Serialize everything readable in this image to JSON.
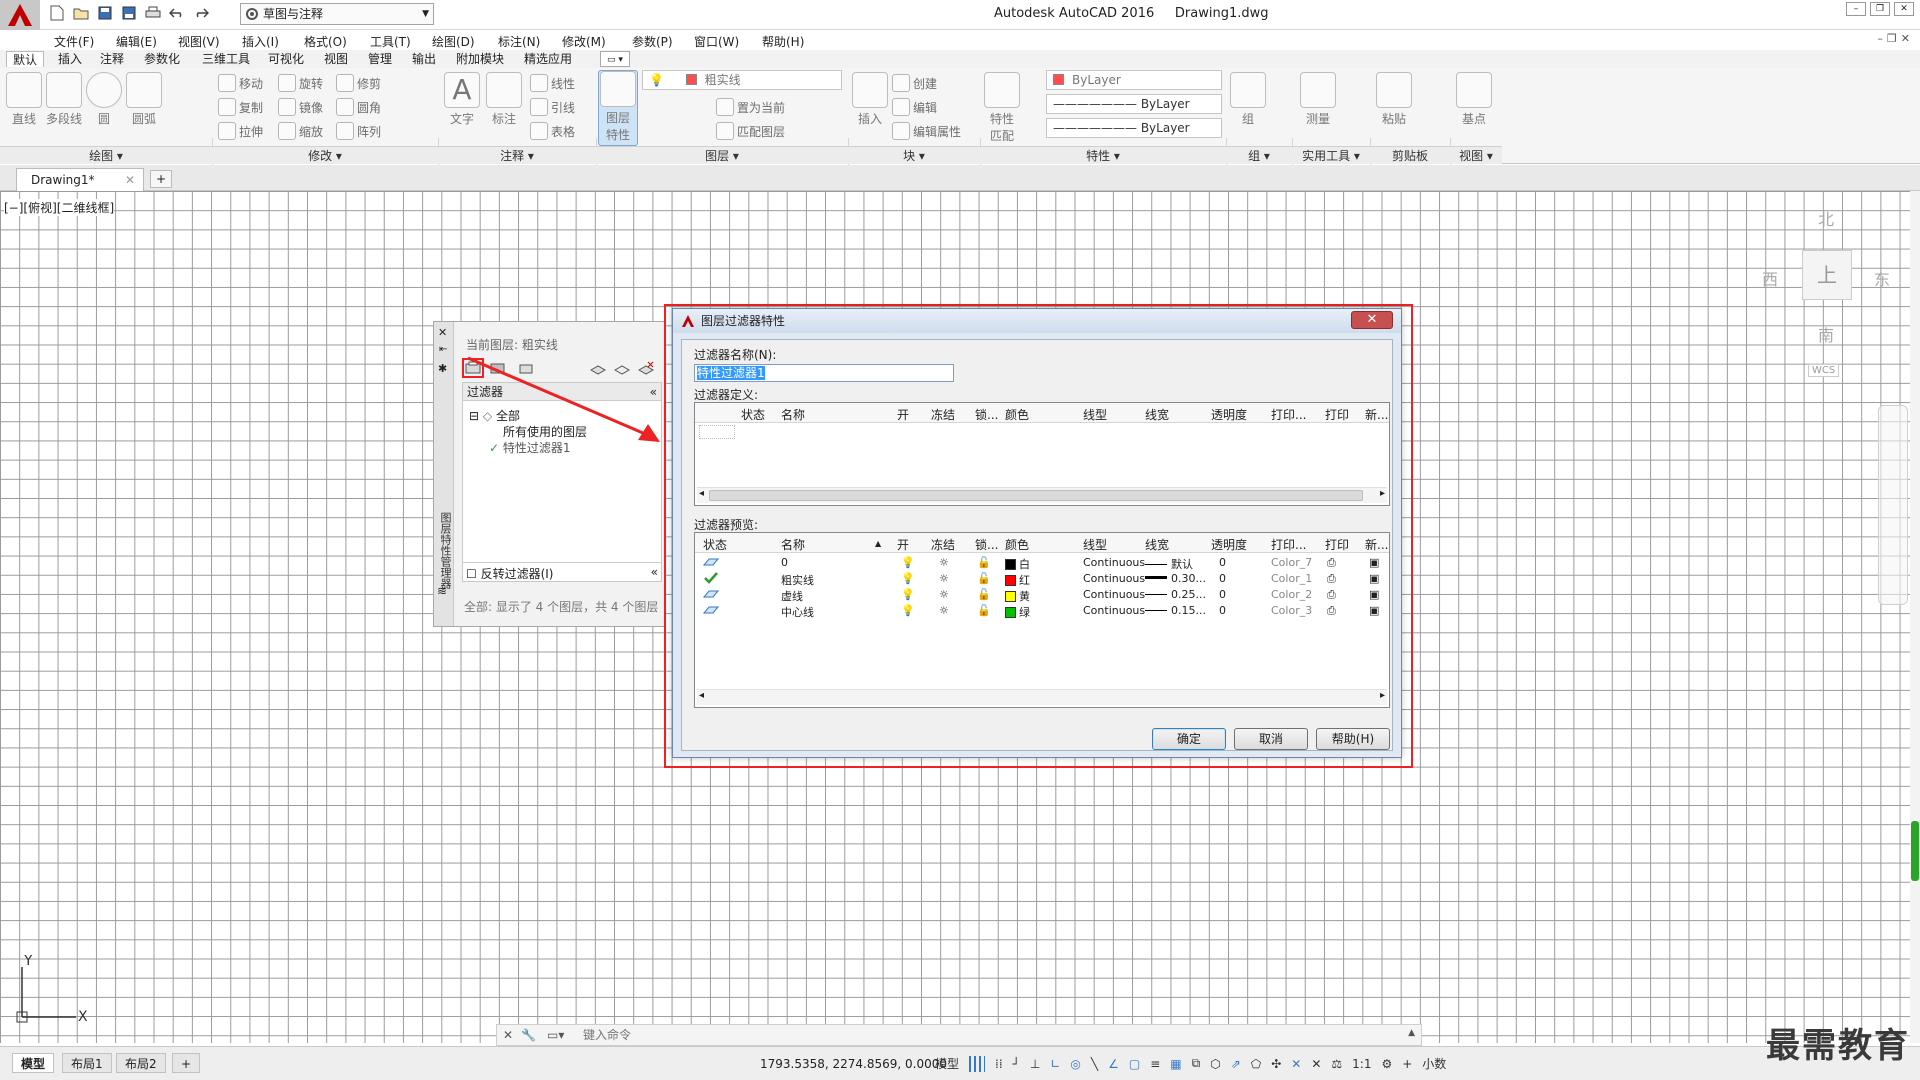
{
  "titlebar": {
    "workspace": "草图与注释",
    "app_title": "Autodesk AutoCAD 2016",
    "doc_title": "Drawing1.dwg"
  },
  "menu": [
    "文件(F)",
    "编辑(E)",
    "视图(V)",
    "插入(I)",
    "格式(O)",
    "工具(T)",
    "绘图(D)",
    "标注(N)",
    "修改(M)",
    "参数(P)",
    "窗口(W)",
    "帮助(H)"
  ],
  "ribbon_tabs": [
    "默认",
    "插入",
    "注释",
    "参数化",
    "三维工具",
    "可视化",
    "视图",
    "管理",
    "输出",
    "附加模块",
    "精选应用"
  ],
  "ribbon": {
    "draw": [
      "直线",
      "多段线",
      "圆",
      "圆弧"
    ],
    "modify": [
      "移动",
      "旋转",
      "修剪",
      "复制",
      "镜像",
      "圆角",
      "拉伸",
      "缩放",
      "阵列"
    ],
    "annotation": [
      "文字",
      "标注",
      "线性",
      "引线",
      "表格"
    ],
    "layers": {
      "big_button": "图层\n特性",
      "current_layer": "粗实线",
      "items": [
        "置为当前",
        "匹配图层"
      ]
    },
    "block": [
      "插入",
      "创建",
      "编辑",
      "编辑属性"
    ],
    "properties": {
      "big_button": "特性\n匹配",
      "color": "ByLayer",
      "linetype": "ByLayer",
      "lineweight": "ByLayer"
    },
    "groups": [
      "组"
    ],
    "utilities": [
      "测量"
    ],
    "clipboard": [
      "粘贴"
    ],
    "view": [
      "基点"
    ],
    "panel_titles": [
      "绘图 ▾",
      "修改 ▾",
      "注释 ▾",
      "图层 ▾",
      "块 ▾",
      "特性 ▾",
      "组 ▾",
      "实用工具 ▾",
      "剪贴板",
      "视图 ▾"
    ]
  },
  "file_tab": "Drawing1*",
  "viewport_label": "[−][俯视][二维线框]",
  "viewcube": {
    "north": "北",
    "south": "南",
    "east": "东",
    "west": "西",
    "top": "上",
    "wcs": "WCS"
  },
  "layer_palette": {
    "current_layer": "当前图层: 粗实线",
    "filters_header": "过滤器",
    "tree": [
      "全部",
      "所有使用的图层",
      "特性过滤器1"
    ],
    "invert_filter": "反转过滤器(I)",
    "status": "全部: 显示了 4 个图层，共 4 个图层",
    "side_title": "图层特性管理器"
  },
  "dialog": {
    "title": "图层过滤器特性",
    "filter_name_label": "过滤器名称(N):",
    "filter_name_value": "特性过滤器1",
    "definition_label": "过滤器定义:",
    "preview_label": "过滤器预览:",
    "columns": [
      "状态",
      "名称",
      "开",
      "冻结",
      "锁...",
      "颜色",
      "线型",
      "线宽",
      "透明度",
      "打印...",
      "打印",
      "新..."
    ],
    "layers": [
      {
        "name": "0",
        "color_name": "白",
        "color": "#000000",
        "linetype": "Continuous",
        "lineweight": "默认",
        "transparency": "0",
        "plot_style": "Color_7",
        "current": false
      },
      {
        "name": "粗实线",
        "color_name": "红",
        "color": "#ff0000",
        "linetype": "Continuous",
        "lineweight": "0.30...",
        "transparency": "0",
        "plot_style": "Color_1",
        "current": true
      },
      {
        "name": "虚线",
        "color_name": "黄",
        "color": "#ffff00",
        "linetype": "Continuous",
        "lineweight": "0.25...",
        "transparency": "0",
        "plot_style": "Color_2",
        "current": false
      },
      {
        "name": "中心线",
        "color_name": "绿",
        "color": "#00c000",
        "linetype": "Continuous",
        "lineweight": "0.15...",
        "transparency": "0",
        "plot_style": "Color_3",
        "current": false
      }
    ],
    "ok": "确定",
    "cancel": "取消",
    "help": "帮助(H)"
  },
  "command_line": {
    "placeholder": "键入命令"
  },
  "statusbar": {
    "layout_tabs": [
      "模型",
      "布局1",
      "布局2"
    ],
    "coordinates": "1793.5358, 2274.8569, 0.0000",
    "model": "模型",
    "scale": "1:1",
    "units": "小数"
  },
  "watermark": "最需教育",
  "accent_color": "#ee2222"
}
